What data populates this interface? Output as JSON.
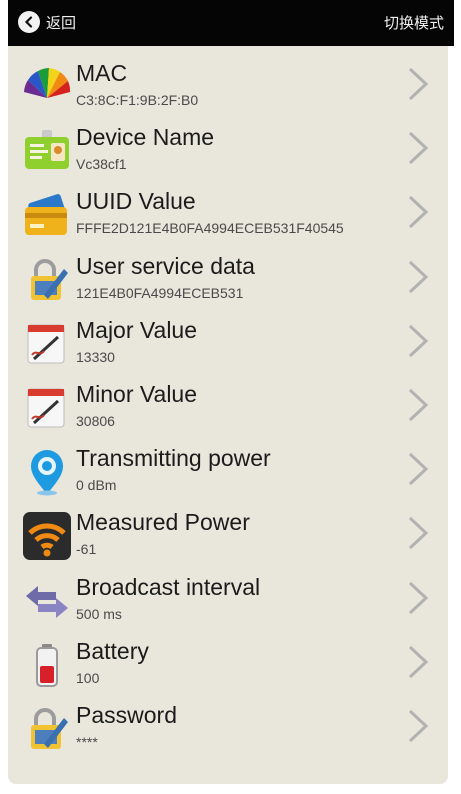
{
  "topbar": {
    "back_label": "返回",
    "mode_label": "切换模式"
  },
  "rows": [
    {
      "title": "MAC",
      "value": "C3:8C:F1:9B:2F:B0",
      "icon": "color-wheel-icon"
    },
    {
      "title": "Device Name",
      "value": "Vc38cf1",
      "icon": "id-card-icon"
    },
    {
      "title": "UUID Value",
      "value": "FFFE2D121E4B0FA4994ECEB531F40545",
      "icon": "credit-card-icon"
    },
    {
      "title": "User service data",
      "value": "121E4B0FA4994ECEB531",
      "icon": "lock-edit-icon"
    },
    {
      "title": "Major Value",
      "value": "13330",
      "icon": "calendar-edit-icon"
    },
    {
      "title": "Minor Value",
      "value": "30806",
      "icon": "calendar-edit-icon"
    },
    {
      "title": "Transmitting power",
      "value": "0 dBm",
      "icon": "location-pin-icon"
    },
    {
      "title": "Measured Power",
      "value": "-61",
      "icon": "wifi-signal-icon"
    },
    {
      "title": "Broadcast interval",
      "value": "500 ms",
      "icon": "double-arrow-icon"
    },
    {
      "title": "Battery",
      "value": "100",
      "icon": "battery-icon"
    },
    {
      "title": "Password",
      "value": "****",
      "icon": "lock-edit-icon"
    }
  ]
}
